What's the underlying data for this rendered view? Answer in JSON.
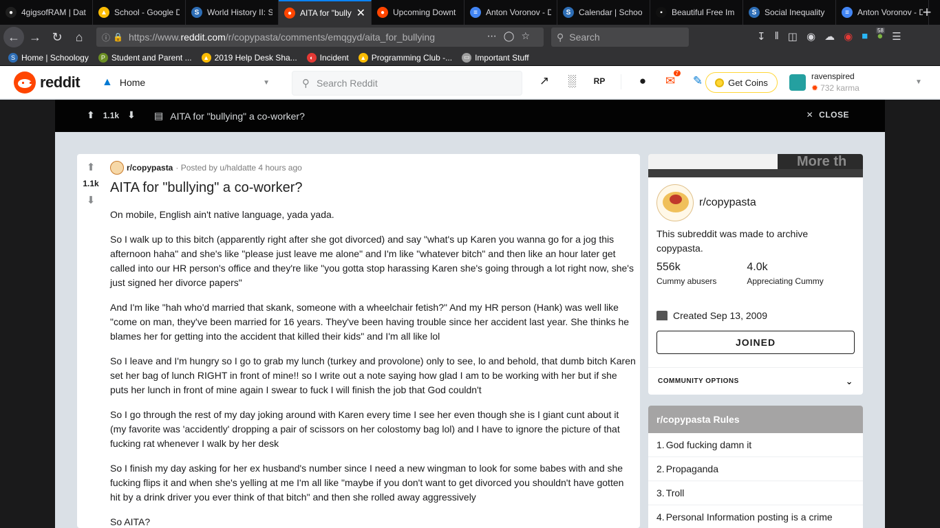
{
  "browser": {
    "tabs": [
      {
        "label": "4gigsofRAM | Dat",
        "fav_color": "#1f1f1f",
        "fav_glyph": "●"
      },
      {
        "label": "School - Google D",
        "fav_color": "#fbbc04",
        "fav_glyph": "▲"
      },
      {
        "label": "World History II: S",
        "fav_color": "#2d6db5",
        "fav_glyph": "S"
      },
      {
        "label": "AITA for \"bully",
        "fav_color": "#ff4500",
        "fav_glyph": "●"
      },
      {
        "label": "Upcoming Downt",
        "fav_color": "#ff4500",
        "fav_glyph": "●"
      },
      {
        "label": "Anton Voronov - D",
        "fav_color": "#4285f4",
        "fav_glyph": "≡"
      },
      {
        "label": "Calendar | Schoo",
        "fav_color": "#2d6db5",
        "fav_glyph": "S"
      },
      {
        "label": "Beautiful Free Im",
        "fav_color": "#111111",
        "fav_glyph": "▪"
      },
      {
        "label": "Social Inequality",
        "fav_color": "#2d6db5",
        "fav_glyph": "S"
      },
      {
        "label": "Anton Voronov - D",
        "fav_color": "#4285f4",
        "fav_glyph": "≡"
      }
    ],
    "active_tab_index": 3,
    "url_prefix": "https://www.",
    "url_domain": "reddit.com",
    "url_path": "/r/copypasta/comments/emqgyd/aita_for_bullying",
    "search_placeholder": "Search",
    "extension_badge": "58",
    "bookmarks": [
      {
        "label": "Home | Schoology",
        "icon_color": "#2d6db5",
        "glyph": "S"
      },
      {
        "label": "Student and Parent ...",
        "icon_color": "#6b8e23",
        "glyph": "P"
      },
      {
        "label": "2019 Help Desk Sha...",
        "icon_color": "#fbbc04",
        "glyph": "▲"
      },
      {
        "label": "Incident",
        "icon_color": "#e53935",
        "glyph": "◐"
      },
      {
        "label": "Programming Club -...",
        "icon_color": "#fbbc04",
        "glyph": "▲"
      },
      {
        "label": "Important Stuff",
        "icon_color": "#9e9e9e",
        "glyph": "▭"
      }
    ]
  },
  "reddit_header": {
    "wordmark": "reddit",
    "home_label": "Home",
    "search_placeholder": "Search Reddit",
    "notification_count": "7",
    "coins_label": "Get Coins",
    "username": "ravenspired",
    "karma": "732 karma"
  },
  "post_bar": {
    "score": "1.1k",
    "title": "AITA for \"bullying\" a co-worker?",
    "close_label": "CLOSE"
  },
  "post": {
    "score": "1.1k",
    "subreddit": "r/copypasta",
    "posted_by": "· Posted by u/haldatte 4 hours ago",
    "title": "AITA for \"bullying\" a co-worker?",
    "paragraphs": [
      "On mobile, English ain't native language, yada yada.",
      "So I walk up to this bitch (apparently right after she got divorced) and say \"what's up Karen you wanna go for a jog this afternoon haha\" and she's like \"please just leave me alone\" and I'm like \"whatever bitch\" and then like an hour later get called into our HR person's office and they're like \"you gotta stop harassing Karen she's going through a lot right now, she's just signed her divorce papers\"",
      "And I'm like \"hah who'd married that skank, someone with a wheelchair fetish?\" And my HR person (Hank) was well like \"come on man, they've been married for 16 years. They've been having trouble since her accident last year. She thinks he blames her for getting into the accident that killed their kids\" and I'm all like lol",
      "So I leave and I'm hungry so I go to grab my lunch (turkey and provolone) only to see, lo and behold, that dumb bitch Karen set her bag of lunch RIGHT in front of mine!! so I write out a note saying how glad I am to be working with her but if she puts her lunch in front of mine again I swear to fuck I will finish the job that God couldn't",
      "So I go through the rest of my day joking around with Karen every time I see her even though she is I giant cunt about it (my favorite was 'accidently' dropping a pair of scissors on her colostomy bag lol) and I have to ignore the picture of that fucking rat whenever I walk by her desk",
      "So I finish my day asking for her ex husband's number since I need a new wingman to look for some babes with and she fucking flips it and when she's yelling at me I'm all like \"maybe if you don't want to get divorced you shouldn't have gotten hit by a drink driver you ever think of that bitch\" and then she rolled away aggressively",
      "So AITA?"
    ]
  },
  "sidebar": {
    "banner_text": "More th",
    "community_name": "r/copypasta",
    "description": "This subreddit was made to archive copypasta.",
    "members": "556k",
    "members_label": "Cummy abusers",
    "online": "4.0k",
    "online_label": "Appreciating Cummy",
    "created": "Created Sep 13, 2009",
    "joined_label": "JOINED",
    "community_options": "COMMUNITY OPTIONS",
    "rules_title": "r/copypasta Rules",
    "rules": [
      {
        "num": "1.",
        "text": "God fucking damn it"
      },
      {
        "num": "2.",
        "text": "Propaganda"
      },
      {
        "num": "3.",
        "text": "Troll"
      },
      {
        "num": "4.",
        "text": "Personal Information posting is a crime"
      }
    ]
  },
  "colors": {
    "reddit_orange": "#ff4500",
    "reddit_blue": "#0079d3",
    "browser_bg": "#0c0c0d",
    "postbar_bg": "#030303"
  }
}
